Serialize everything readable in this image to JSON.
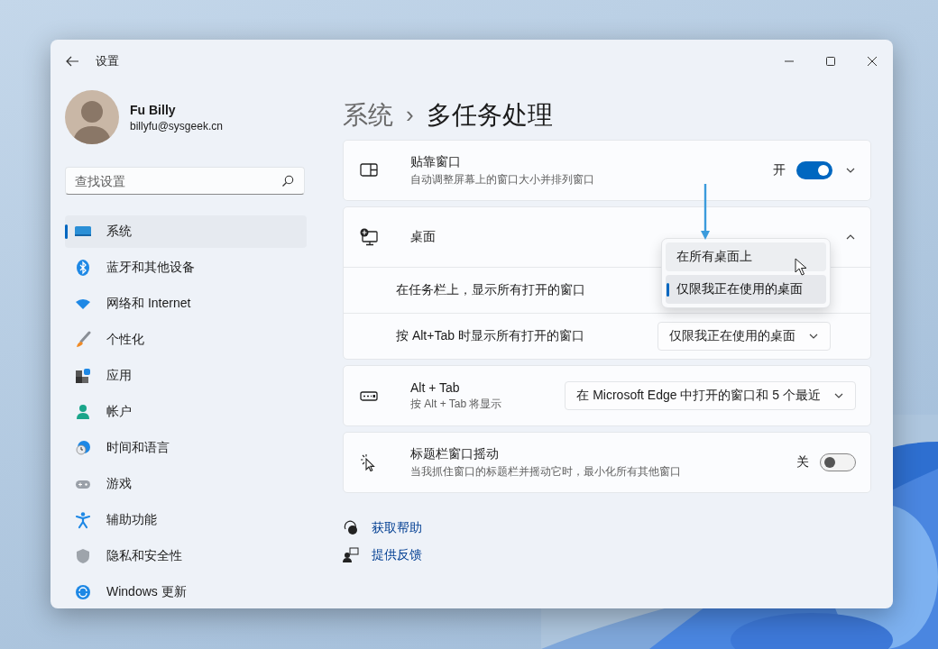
{
  "window": {
    "title": "设置"
  },
  "account": {
    "name": "Fu Billy",
    "email": "billyfu@sysgeek.cn"
  },
  "search": {
    "placeholder": "查找设置"
  },
  "nav": [
    {
      "label": "系统",
      "selected": true
    },
    {
      "label": "蓝牙和其他设备",
      "selected": false
    },
    {
      "label": "网络和 Internet",
      "selected": false
    },
    {
      "label": "个性化",
      "selected": false
    },
    {
      "label": "应用",
      "selected": false
    },
    {
      "label": "帐户",
      "selected": false
    },
    {
      "label": "时间和语言",
      "selected": false
    },
    {
      "label": "游戏",
      "selected": false
    },
    {
      "label": "辅助功能",
      "selected": false
    },
    {
      "label": "隐私和安全性",
      "selected": false
    },
    {
      "label": "Windows 更新",
      "selected": false
    }
  ],
  "breadcrumb": {
    "parent": "系统",
    "separator": "›",
    "current": "多任务处理"
  },
  "settings": [
    {
      "kind": "toggle",
      "title": "贴靠窗口",
      "description": "自动调整屏幕上的窗口大小并排列窗口",
      "state_label": "开",
      "on": true,
      "expanded": false
    },
    {
      "kind": "expander",
      "title": "桌面",
      "expanded": true,
      "rows": [
        {
          "label": "在任务栏上，显示所有打开的窗口",
          "dropdown": {
            "open": true,
            "options": [
              {
                "label": "在所有桌面上",
                "selected": false,
                "hovered": true
              },
              {
                "label": "仅限我正在使用的桌面",
                "selected": true,
                "hovered": false
              }
            ]
          }
        },
        {
          "label": "按 Alt+Tab 时显示所有打开的窗口",
          "dropdown": {
            "open": false,
            "value": "仅限我正在使用的桌面"
          }
        }
      ]
    },
    {
      "kind": "dropdown",
      "title": "Alt + Tab",
      "description": "按 Alt + Tab 将显示",
      "value": "在 Microsoft Edge 中打开的窗口和 5 个最近"
    },
    {
      "kind": "toggle",
      "title": "标题栏窗口摇动",
      "description": "当我抓住窗口的标题栏并摇动它时，最小化所有其他窗口",
      "state_label": "关",
      "on": false
    }
  ],
  "links": [
    {
      "label": "获取帮助"
    },
    {
      "label": "提供反馈"
    }
  ]
}
